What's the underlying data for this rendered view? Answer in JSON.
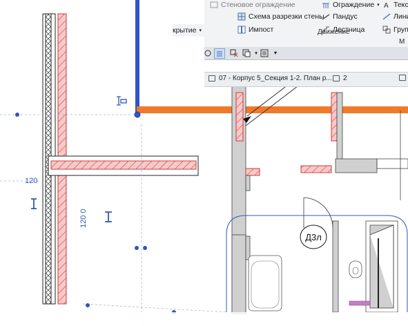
{
  "ribbon": {
    "items": {
      "wall_sweep": "Стеновое ограждение",
      "wall_profile": "Схема разрезки стены",
      "mullion": "Импост",
      "covering": "крытие",
      "railing": "Ограждение",
      "ramp": "Пандус",
      "stair": "Лестница",
      "text": "Текст",
      "lines": "Лини",
      "group": "Групп"
    },
    "groups": {
      "circulation": "Движение",
      "model": "М"
    }
  },
  "view_tabs": {
    "active": "07 - Корпус 5_Секция 1-2. План р...",
    "second": "2"
  },
  "drawing": {
    "dim_120_horizontal": "120",
    "dim_120_vertical": "120 0",
    "door_tag": "Д3л"
  },
  "colors": {
    "blue_wall": "#2e55c9",
    "orange_wall": "#f07a2a",
    "hatch_pink": "#f3b4b4",
    "hatch_red": "#d13b3b",
    "dim_blue": "#2d58b3",
    "grey_wall": "#d0d0d0"
  },
  "icons": [
    "wall-sweep-icon",
    "curtain-grid-icon",
    "mullion-icon",
    "railing-icon",
    "ramp-icon",
    "stair-icon",
    "text-icon",
    "model-line-icon",
    "model-group-icon"
  ]
}
